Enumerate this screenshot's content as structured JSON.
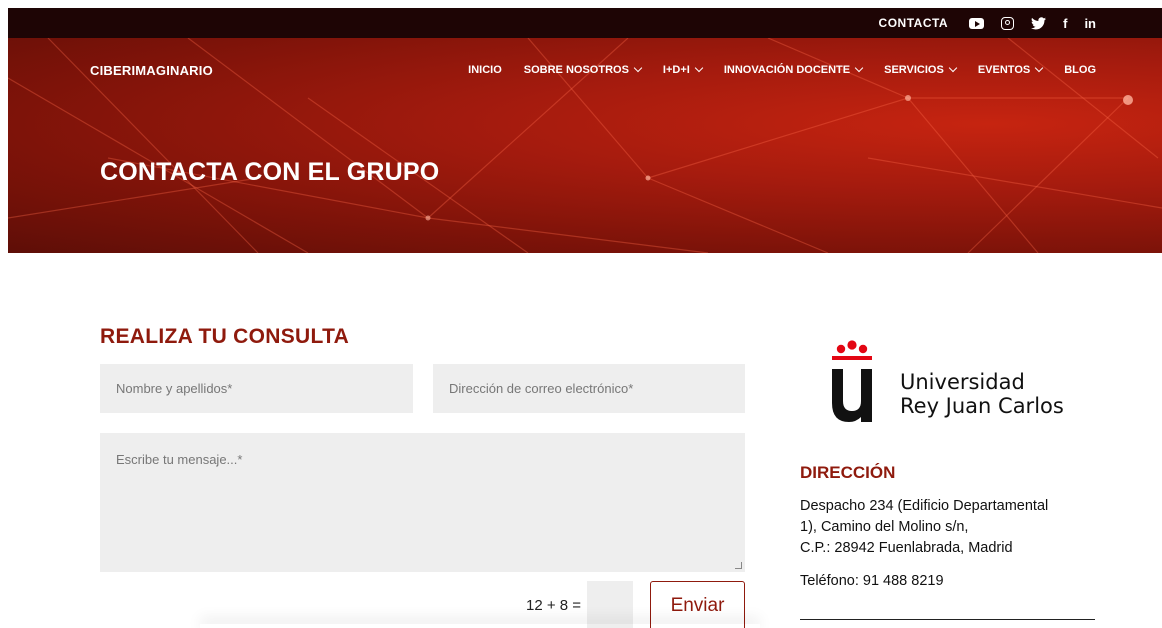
{
  "topbar": {
    "contact_label": "CONTACTA",
    "social": [
      "youtube-icon",
      "instagram-icon",
      "twitter-icon",
      "facebook-icon",
      "linkedin-icon"
    ],
    "twitter_glyph": "🐦",
    "facebook_glyph": "f",
    "linkedin_glyph": "in"
  },
  "header": {
    "logo_text": "CIBERIMAGINARIO",
    "nav": [
      {
        "label": "INICIO",
        "has_dropdown": false
      },
      {
        "label": "SOBRE NOSOTROS",
        "has_dropdown": true
      },
      {
        "label": "I+D+I",
        "has_dropdown": true
      },
      {
        "label": "INNOVACIÓN DOCENTE",
        "has_dropdown": true
      },
      {
        "label": "SERVICIOS",
        "has_dropdown": true
      },
      {
        "label": "EVENTOS",
        "has_dropdown": true
      },
      {
        "label": "BLOG",
        "has_dropdown": false
      }
    ],
    "hero_title": "CONTACTA CON EL GRUPO"
  },
  "form": {
    "title": "REALIZA TU CONSULTA",
    "name_placeholder": "Nombre y apellidos*",
    "email_placeholder": "Dirección de correo electrónico*",
    "message_placeholder": "Escribe tu mensaje...*",
    "captcha_question": "12 + 8 =",
    "submit_label": "Enviar"
  },
  "sidebar": {
    "university_line1": "Universidad",
    "university_line2": "Rey Juan Carlos",
    "address_title": "DIRECCIÓN",
    "address_line1": "Despacho 234 (Edificio Departamental",
    "address_line2": "1), Camino del Molino s/n,",
    "address_line3": "C.P.: 28942 Fuenlabrada, Madrid",
    "phone": "Teléfono: 91 488 8219"
  },
  "colors": {
    "brand_red": "#8f1a0d",
    "topbar_bg": "#1e0505",
    "field_bg": "#eeeeee",
    "urjc_red": "#e30613"
  }
}
